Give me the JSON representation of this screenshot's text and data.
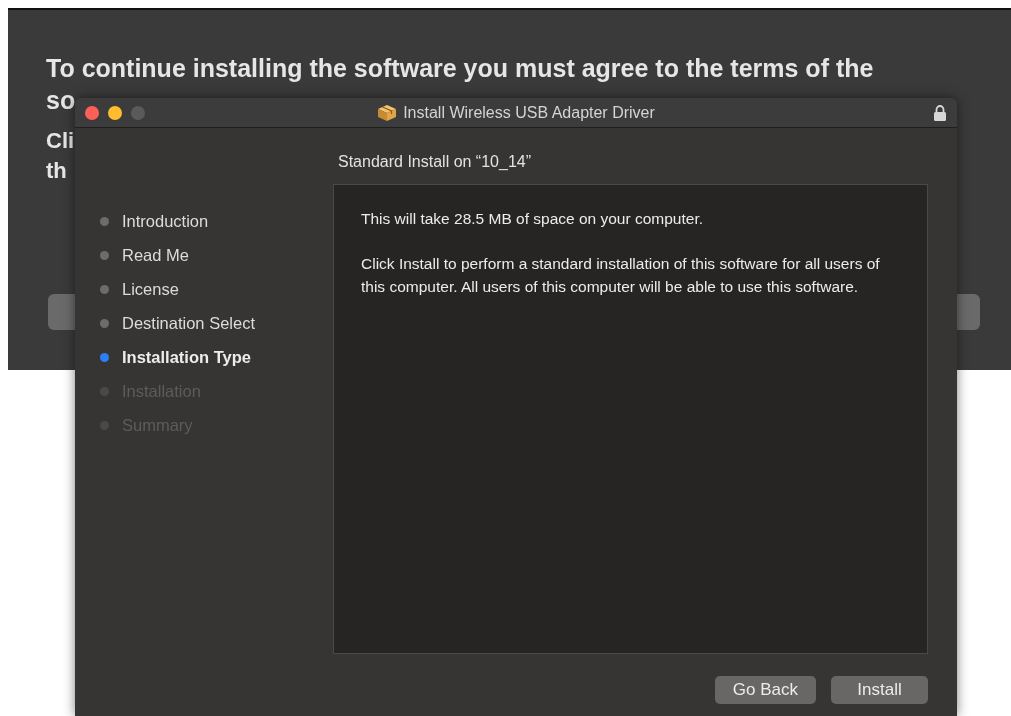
{
  "background_sheet": {
    "heading_line_1": "To continue installing the software you must agree to the terms of the",
    "heading_line_2": "so",
    "body_line_1": "Cli",
    "body_line_2": "th"
  },
  "window": {
    "title": "Install Wireless USB Adapter Driver"
  },
  "sidebar": {
    "items": [
      {
        "label": "Introduction",
        "selected": false,
        "disabled": false
      },
      {
        "label": "Read Me",
        "selected": false,
        "disabled": false
      },
      {
        "label": "License",
        "selected": false,
        "disabled": false
      },
      {
        "label": "Destination Select",
        "selected": false,
        "disabled": false
      },
      {
        "label": "Installation Type",
        "selected": true,
        "disabled": false
      },
      {
        "label": "Installation",
        "selected": false,
        "disabled": true
      },
      {
        "label": "Summary",
        "selected": false,
        "disabled": true
      }
    ]
  },
  "content": {
    "heading": "Standard Install on “10_14”",
    "paragraphs": [
      "This will take 28.5 MB of space on your computer.",
      "Click Install to perform a standard installation of this software for all users of this computer. All users of this computer will be able to use this software."
    ]
  },
  "buttons": [
    "Go Back",
    "Install"
  ]
}
